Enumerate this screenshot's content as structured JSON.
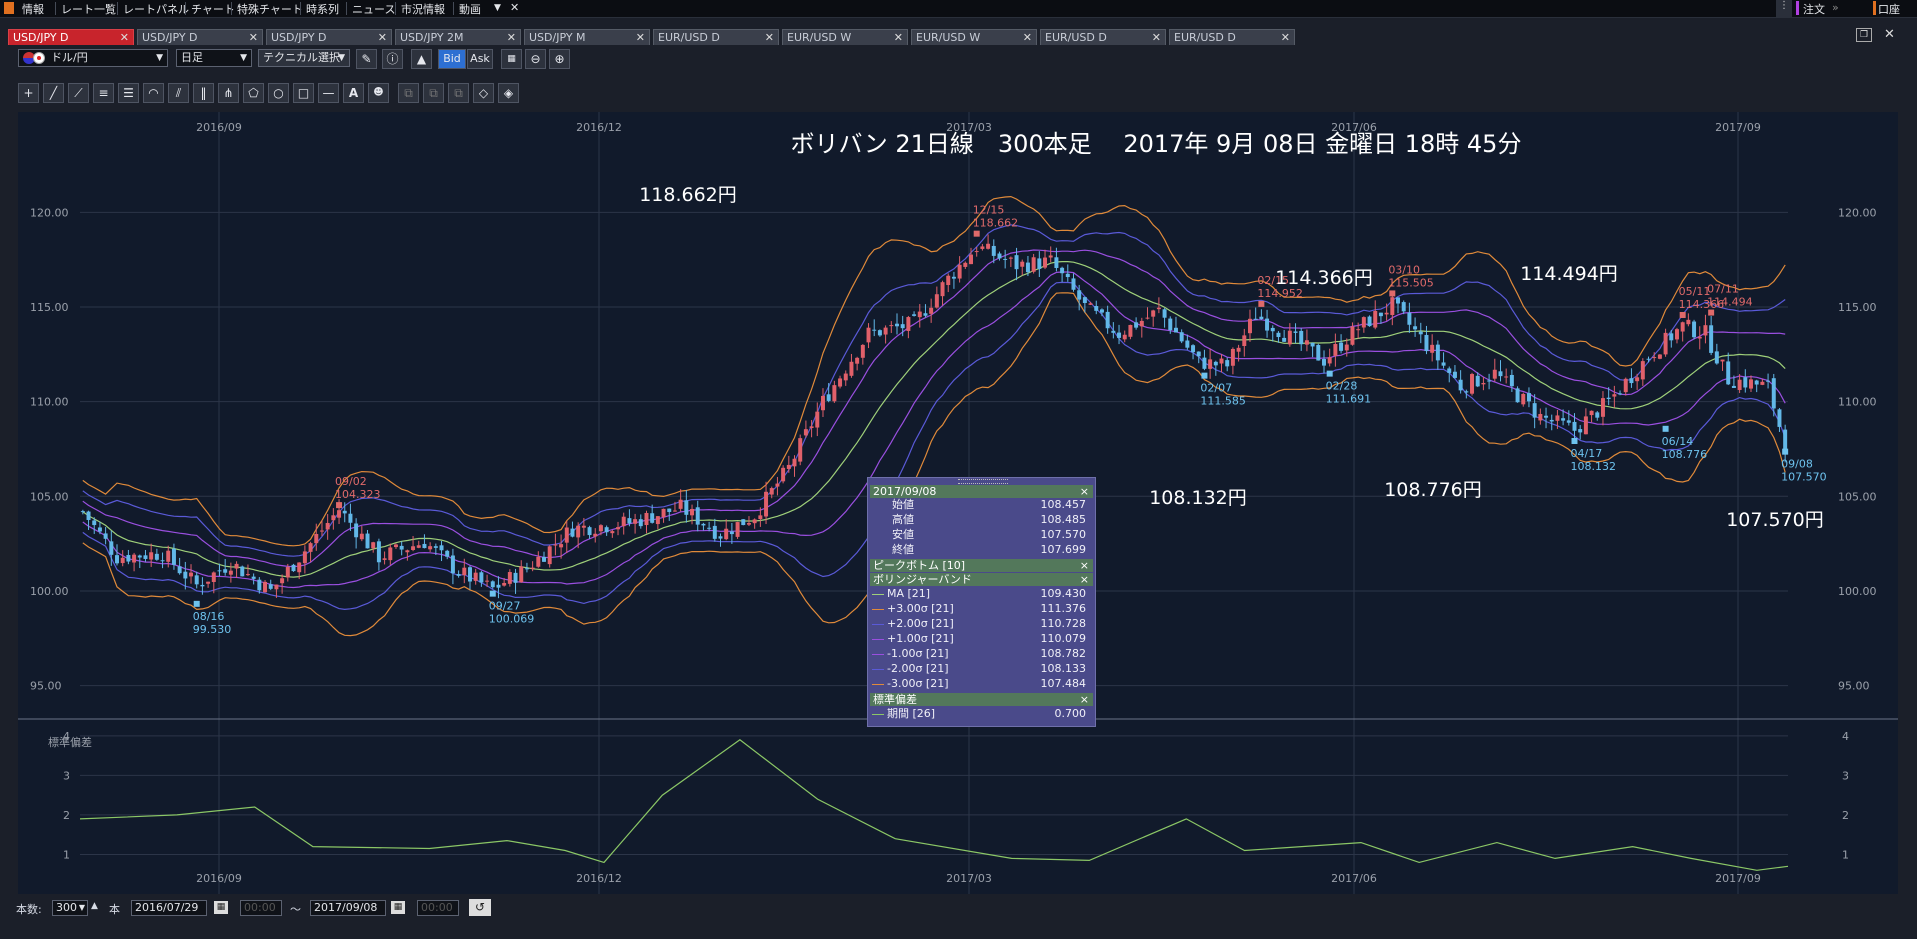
{
  "menu": {
    "items": [
      "情報",
      "レート一覧",
      "レートパネル",
      "チャート",
      "特殊チャート",
      "時系列",
      "ニュース",
      "市況情報",
      "動画"
    ],
    "right_order": "注文",
    "right_account": "口座"
  },
  "tabs": [
    {
      "label": "USD/JPY D",
      "active": true
    },
    {
      "label": "USD/JPY D",
      "active": false
    },
    {
      "label": "USD/JPY D",
      "active": false
    },
    {
      "label": "USD/JPY 2M",
      "active": false
    },
    {
      "label": "USD/JPY M",
      "active": false
    },
    {
      "label": "EUR/USD D",
      "active": false
    },
    {
      "label": "EUR/USD W",
      "active": false
    },
    {
      "label": "EUR/USD W",
      "active": false
    },
    {
      "label": "EUR/USD D",
      "active": false
    },
    {
      "label": "EUR/USD D",
      "active": false
    }
  ],
  "toolbar": {
    "currency_pair": "ドル/円",
    "timeframe": "日足",
    "technical_select": "テクニカル選択",
    "bid_label": "Bid",
    "ask_label": "Ask"
  },
  "chart_data": {
    "type": "candlestick",
    "title": "ボリバン 21日線　300本足　 2017年 9月 08日 金曜日 18時 45分",
    "x_ticks": [
      "2016/09",
      "2016/12",
      "2017/03",
      "2017/06",
      "2017/09"
    ],
    "y_ticks": [
      "120.00",
      "115.00",
      "110.00",
      "105.00",
      "100.00",
      "95.00"
    ],
    "ylim": [
      93.5,
      125.3
    ],
    "big_annotations": [
      "118.662円",
      "114.366円",
      "114.494円",
      "108.132円",
      "108.776円",
      "107.570円"
    ],
    "markers": [
      {
        "date": "09/02",
        "value": "104.323",
        "kind": "peak"
      },
      {
        "date": "12/15",
        "value": "118.662",
        "kind": "peak"
      },
      {
        "date": "02/15",
        "value": "114.952",
        "kind": "peak"
      },
      {
        "date": "03/10",
        "value": "115.505",
        "kind": "peak"
      },
      {
        "date": "05/11",
        "value": "114.366",
        "kind": "peak"
      },
      {
        "date": "07/11",
        "value": "114.494",
        "kind": "peak"
      },
      {
        "date": "08/16",
        "value": "99.530",
        "kind": "bottom"
      },
      {
        "date": "09/27",
        "value": "100.069",
        "kind": "bottom"
      },
      {
        "date": "02/07",
        "value": "111.585",
        "kind": "bottom"
      },
      {
        "date": "02/28",
        "value": "111.691",
        "kind": "bottom"
      },
      {
        "date": "04/17",
        "value": "108.132",
        "kind": "bottom"
      },
      {
        "date": "06/14",
        "value": "108.776",
        "kind": "bottom"
      },
      {
        "date": "09/08",
        "value": "107.570",
        "kind": "bottom"
      }
    ],
    "sub_chart": {
      "label": "標準偏差",
      "y_ticks": [
        "4",
        "3",
        "2",
        "1"
      ],
      "ylim": [
        0,
        4.3
      ]
    },
    "colors": {
      "up": "#e0606a",
      "down": "#62b8e8",
      "ma": "#9fd07a",
      "sigma1": "#9a4fe0",
      "sigma2": "#5a5ad8",
      "sigma3": "#e08a3a",
      "stddev": "#8bc766"
    }
  },
  "info_panel": {
    "date": "2017/09/08",
    "ohlc": [
      {
        "label": "始値",
        "value": "108.457"
      },
      {
        "label": "高値",
        "value": "108.485"
      },
      {
        "label": "安値",
        "value": "107.570"
      },
      {
        "label": "終値",
        "value": "107.699"
      }
    ],
    "peak_bottom": "ピークボトム [10]",
    "bollinger": "ボリンジャーバンド",
    "bands": [
      {
        "label": "MA [21]",
        "value": "109.430",
        "color": "#9fd07a"
      },
      {
        "label": "+3.00σ [21]",
        "value": "111.376",
        "color": "#e08a3a"
      },
      {
        "label": "+2.00σ [21]",
        "value": "110.728",
        "color": "#5a5ad8"
      },
      {
        "label": "+1.00σ [21]",
        "value": "110.079",
        "color": "#9a4fe0"
      },
      {
        "label": "-1.00σ [21]",
        "value": "108.782",
        "color": "#9a4fe0"
      },
      {
        "label": "-2.00σ [21]",
        "value": "108.133",
        "color": "#5a5ad8"
      },
      {
        "label": "-3.00σ [21]",
        "value": "107.484",
        "color": "#e08a3a"
      }
    ],
    "stddev_header": "標準偏差",
    "stddev_row": {
      "label": "期間 [26]",
      "value": "0.700",
      "color": "#8bc766"
    }
  },
  "bottombar": {
    "count_label": "本数:",
    "count_value": "300",
    "unit": "本",
    "start_date": "2016/07/29",
    "start_time": "00:00",
    "tilde": "〜",
    "end_date": "2017/09/08",
    "end_time": "00:00"
  }
}
